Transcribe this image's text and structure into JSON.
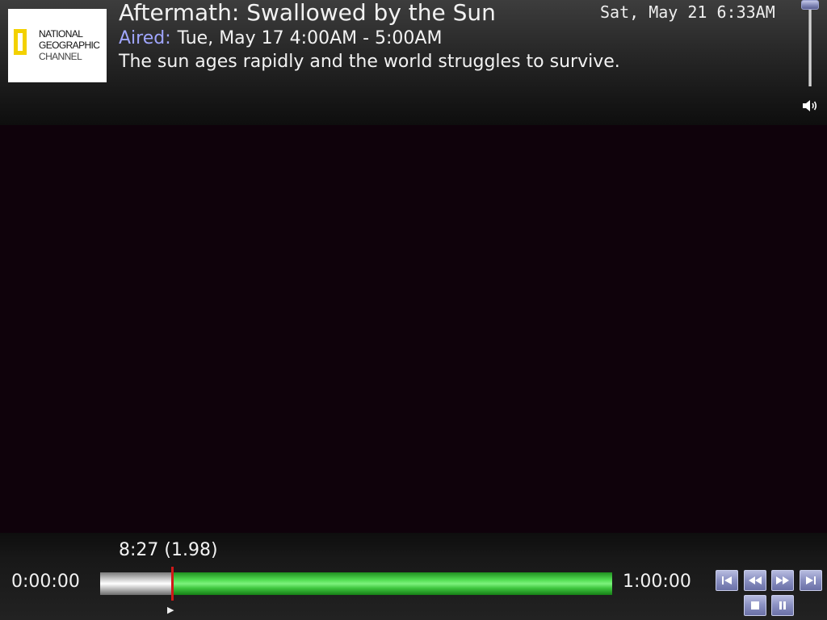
{
  "channel_logo": {
    "lines": [
      "NATIONAL",
      "GEOGRAPHIC",
      "CHANNEL"
    ],
    "frame_color": "#f3d100"
  },
  "program": {
    "title": "Aftermath: Swallowed by the Sun",
    "aired_label": "Aired:",
    "aired_value": "Tue, May 17 4:00AM - 5:00AM",
    "description": "The sun ages rapidly and the world struggles to survive."
  },
  "clock": "Sat, May 21 6:33AM",
  "volume": {
    "level": 1.0,
    "icon": "speaker-icon"
  },
  "playback": {
    "position_label": "8:27 (1.98)",
    "start_time": "0:00:00",
    "end_time": "1:00:00",
    "watched_fraction": 0.141,
    "state_icon": "play-indicator-icon"
  },
  "controls": [
    {
      "name": "skip-back-button",
      "icon": "skip-back-icon"
    },
    {
      "name": "rewind-button",
      "icon": "rewind-icon"
    },
    {
      "name": "fast-forward-button",
      "icon": "fast-forward-icon"
    },
    {
      "name": "skip-forward-button",
      "icon": "skip-forward-icon"
    },
    {
      "name": "stop-button",
      "icon": "stop-icon"
    },
    {
      "name": "pause-button",
      "icon": "pause-icon"
    }
  ],
  "colors": {
    "background": "#0f020b",
    "aired_label": "#a0a6ff",
    "progress_remaining": "#56e056",
    "progress_cursor": "#d01818"
  }
}
